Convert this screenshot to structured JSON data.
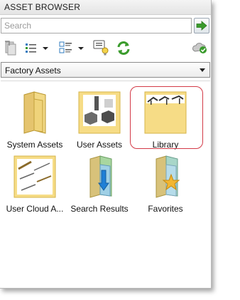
{
  "panel": {
    "title": "ASSET BROWSER"
  },
  "search": {
    "placeholder": "Search",
    "value": ""
  },
  "toolbar": {
    "icons": [
      "import-icon",
      "list-view-icon",
      "dropdown-caret-icon",
      "detail-view-icon",
      "dropdown-caret-icon",
      "tooltip-icon",
      "refresh-icon",
      "cloud-sync-icon"
    ]
  },
  "source_dropdown": {
    "selected": "Factory Assets"
  },
  "tiles": [
    {
      "label": "System Assets",
      "icon": "folder-icon"
    },
    {
      "label": "User Assets",
      "icon": "user-assets-thumbnail"
    },
    {
      "label": "Library",
      "icon": "library-thumbnail",
      "selected": true
    },
    {
      "label": "User Cloud A...",
      "icon": "user-cloud-assets-thumbnail"
    },
    {
      "label": "Search Results",
      "icon": "search-results-folder-icon"
    },
    {
      "label": "Favorites",
      "icon": "favorites-folder-icon"
    }
  ],
  "colors": {
    "accent_green": "#3a9b2c",
    "selection_ring": "#d33a47",
    "folder_yellow": "#f6dc86"
  }
}
